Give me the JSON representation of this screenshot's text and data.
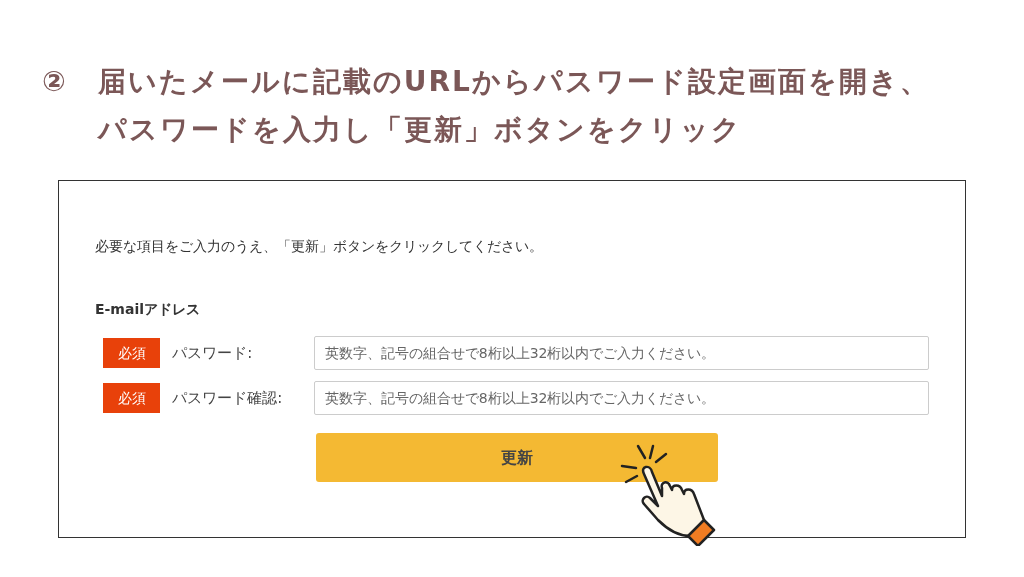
{
  "heading": {
    "step": "②",
    "lines": [
      "届いたメールに記載のURLからパスワード設定画面を開き、",
      "パスワードを入力し「更新」ボタンをクリック"
    ]
  },
  "form": {
    "instruction": "必要な項目をご入力のうえ、「更新」ボタンをクリックしてください。",
    "email_label": "E-mailアドレス",
    "fields": [
      {
        "badge": "必須",
        "label": "パスワード:",
        "placeholder": "英数字、記号の組合せで8桁以上32桁以内でご入力ください。"
      },
      {
        "badge": "必須",
        "label": "パスワード確認:",
        "placeholder": "英数字、記号の組合せで8桁以上32桁以内でご入力ください。"
      }
    ],
    "submit": "更新"
  }
}
